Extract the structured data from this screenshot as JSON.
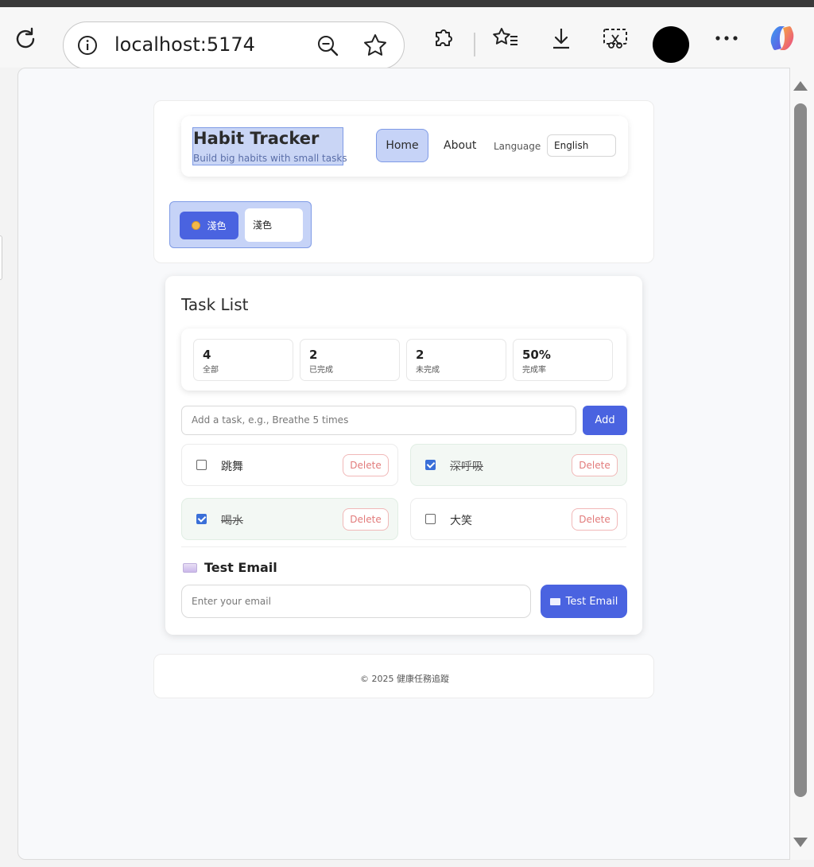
{
  "browser": {
    "url": "localhost:5174"
  },
  "nav": {
    "brand_title": "Habit Tracker",
    "brand_subtitle": "Build big habits with small tasks",
    "home_label": "Home",
    "about_label": "About",
    "language_label": "Language",
    "language_value": "English"
  },
  "theme": {
    "button_label": "淺色",
    "select_value": "淺色"
  },
  "tasks": {
    "title": "Task List",
    "stats": [
      {
        "value": "4",
        "label": "全部"
      },
      {
        "value": "2",
        "label": "已完成"
      },
      {
        "value": "2",
        "label": "未完成"
      },
      {
        "value": "50%",
        "label": "完成率"
      }
    ],
    "add_placeholder": "Add a task, e.g., Breathe 5 times",
    "add_label": "Add",
    "delete_label": "Delete",
    "items": [
      {
        "name": "跳舞",
        "done": false
      },
      {
        "name": "深呼吸",
        "done": true
      },
      {
        "name": "喝水",
        "done": true
      },
      {
        "name": "大笑",
        "done": false
      }
    ]
  },
  "email": {
    "heading": "Test Email",
    "placeholder": "Enter your email",
    "button_label": "Test Email"
  },
  "footer": {
    "text": "© 2025 健康任務追蹤"
  },
  "colors": {
    "accent": "#4a63e0",
    "highlight": "#c6d3f7",
    "delete": "#e27b7b",
    "done_bg": "#f3f8f4"
  }
}
